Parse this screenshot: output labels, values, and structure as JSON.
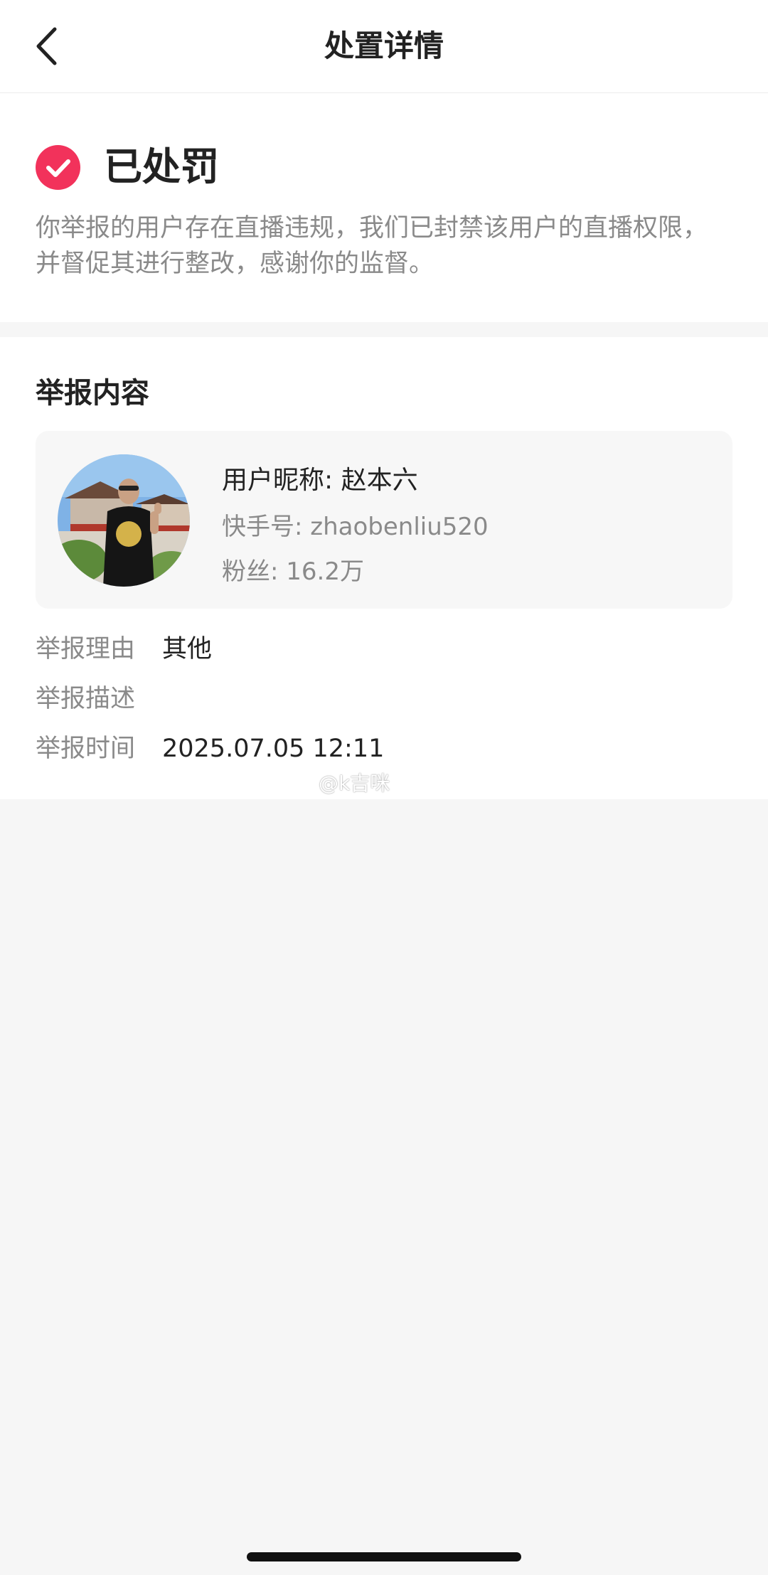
{
  "nav": {
    "title": "处置详情",
    "back_icon": "chevron-left-icon"
  },
  "status": {
    "icon": "check-circle-icon",
    "icon_color": "#f2325b",
    "title": "已处罚",
    "description": "你举报的用户存在直播违规，我们已封禁该用户的直播权限，并督促其进行整改，感谢你的监督。"
  },
  "report": {
    "section_title": "举报内容",
    "user": {
      "nickname": "用户昵称: 赵本六",
      "kuaishou_id": "快手号: zhaobenliu520",
      "fans": "粉丝: 16.2万"
    },
    "rows": [
      {
        "label": "举报理由",
        "value": "其他"
      },
      {
        "label": "举报描述",
        "value": ""
      },
      {
        "label": "举报时间",
        "value": "2025.07.05 12:11"
      }
    ]
  },
  "watermark": "@k吉咪"
}
